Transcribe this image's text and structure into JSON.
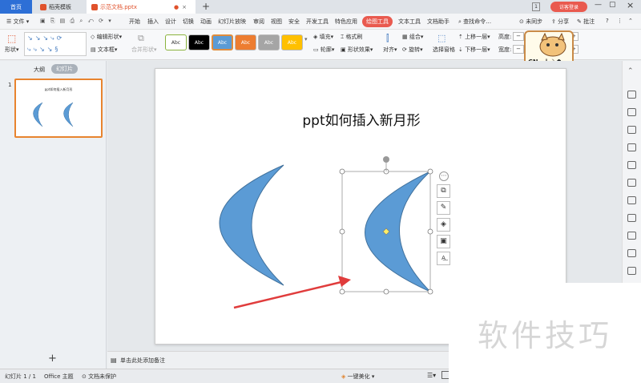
{
  "tabs": {
    "home": "首页",
    "templates": "稻壳模板",
    "file": "示范文档.pptx"
  },
  "titlebar": {
    "badge": "1",
    "login": "访客登录"
  },
  "menu": {
    "file": "文件",
    "items": [
      "开始",
      "插入",
      "设计",
      "切换",
      "动画",
      "幻灯片放映",
      "审阅",
      "视图",
      "安全",
      "开发工具",
      "特色应用"
    ],
    "active": "绘图工具",
    "extra": [
      "文本工具",
      "文档助手"
    ],
    "search": "查找命令…",
    "sync": "未同步",
    "share": "分享",
    "comment": "批注"
  },
  "ribbon": {
    "shape": "形状",
    "edit_shape": "编辑形状",
    "text_box": "文本框",
    "merge_shape": "合并形状",
    "style_label": "Abc",
    "fill": "填充",
    "format_brush": "格式刷",
    "outline": "轮廓",
    "shape_effect": "形状效果",
    "align": "对齐",
    "group": "组合",
    "rotate": "旋转",
    "select_pane": "选择窗格",
    "bring_forward": "上移一层",
    "send_backward": "下移一层",
    "height": "高度:",
    "width": "宽度:"
  },
  "colors": {
    "style_fills": [
      "#ffffff",
      "#000000",
      "#5b9bd5",
      "#ed7d31",
      "#a5a5a5",
      "#ffc000"
    ],
    "accent": "#2d6fd6",
    "shape": "#5b9bd5",
    "arrow": "#e03c3c"
  },
  "leftpane": {
    "outline": "大纲",
    "slides": "幻灯片",
    "slide_number": "1",
    "thumb_title": "ppt如何插入新月形"
  },
  "slide": {
    "title": "ppt如何插入新月形"
  },
  "notes": {
    "placeholder": "单击此处添加备注"
  },
  "status": {
    "slide": "幻灯片 1 / 1",
    "theme": "Office 主题",
    "protect": "文档未保护",
    "beautify": "一键美化"
  },
  "watermark": "软件技巧",
  "ime": {
    "label": "CN"
  }
}
